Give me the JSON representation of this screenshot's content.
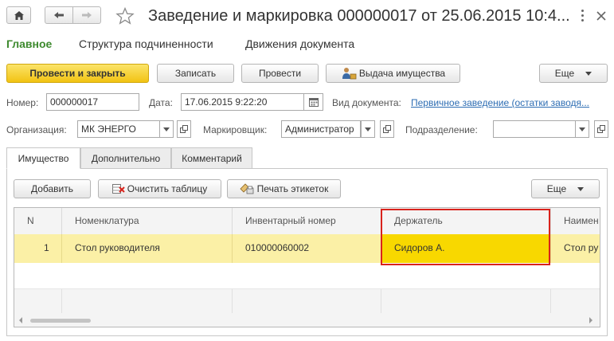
{
  "window": {
    "title": "Заведение и маркировка 000000017 от 25.06.2015 10:4..."
  },
  "nav": {
    "main": "Главное",
    "structure": "Структура подчиненности",
    "movements": "Движения документа"
  },
  "toolbar": {
    "post_close": "Провести и закрыть",
    "write": "Записать",
    "post": "Провести",
    "issue": "Выдача имущества",
    "more": "Еще"
  },
  "form": {
    "number_label": "Номер:",
    "number_value": "000000017",
    "date_label": "Дата:",
    "date_value": "17.06.2015  9:22:20",
    "doctype_label": "Вид документа:",
    "doctype_value": "Первичное заведение (остатки заводя...",
    "org_label": "Организация:",
    "org_value": "МК ЭНЕРГО",
    "marker_label": "Маркировщик:",
    "marker_value": "Администратор",
    "dept_label": "Подразделение:",
    "dept_value": ""
  },
  "tabs": [
    "Имущество",
    "Дополнительно",
    "Комментарий"
  ],
  "table_toolbar": {
    "add": "Добавить",
    "clear": "Очистить таблицу",
    "print": "Печать этикеток",
    "more": "Еще"
  },
  "table": {
    "columns": [
      "N",
      "Номенклатура",
      "Инвентарный номер",
      "Держатель",
      "Наимен"
    ],
    "rows": [
      {
        "n": "1",
        "item": "Стол руководителя",
        "inv": "010000060002",
        "holder": "Сидоров А.",
        "name": "Стол ру"
      }
    ]
  },
  "colors": {
    "accent_green": "#3d8a2e",
    "primary_yellow": "#f6cd25",
    "selected_row": "#fbf0a6",
    "highlight_cell": "#f8d800",
    "highlight_border": "#d9231c",
    "link_blue": "#2d6db3"
  },
  "icons": [
    "home-icon",
    "back-arrow-icon",
    "forward-arrow-icon",
    "star-icon",
    "more-icon",
    "close-icon",
    "issue-icon",
    "calendar-icon",
    "clear-table-icon",
    "print-labels-icon"
  ]
}
